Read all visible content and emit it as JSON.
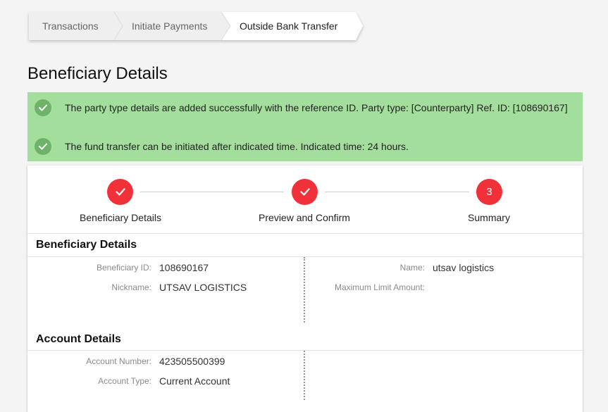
{
  "breadcrumb": {
    "items": [
      {
        "label": "Transactions"
      },
      {
        "label": "Initiate Payments"
      },
      {
        "label": "Outside Bank Transfer"
      }
    ]
  },
  "page": {
    "title": "Beneficiary Details"
  },
  "alerts": [
    {
      "text": "The party type details are added successfully with the reference ID. Party type: [Counterparty] Ref. ID: [108690167]"
    },
    {
      "text": "The fund transfer can be initiated after indicated time. Indicated time: 24 hours."
    }
  ],
  "stepper": {
    "steps": [
      {
        "label": "Beneficiary Details",
        "state": "completed",
        "number": "1"
      },
      {
        "label": "Preview and Confirm",
        "state": "completed",
        "number": "2"
      },
      {
        "label": "Summary",
        "state": "current",
        "number": "3"
      }
    ]
  },
  "beneficiary_section": {
    "heading": "Beneficiary Details",
    "left": [
      {
        "label": "Beneficiary ID:",
        "value": "108690167"
      },
      {
        "label": "Nickname:",
        "value": "UTSAV LOGISTICS"
      }
    ],
    "right": [
      {
        "label": "Name:",
        "value": "utsav logistics"
      },
      {
        "label": "Maximum Limit Amount:",
        "value": ""
      }
    ]
  },
  "account_section": {
    "heading": "Account Details",
    "left": [
      {
        "label": "Account Number:",
        "value": "423505500399"
      },
      {
        "label": "Account Type:",
        "value": "Current Account"
      }
    ]
  },
  "colors": {
    "accent_red": "#f1313a",
    "success_bg": "#a3de9d",
    "success_icon": "#6fb36a"
  }
}
